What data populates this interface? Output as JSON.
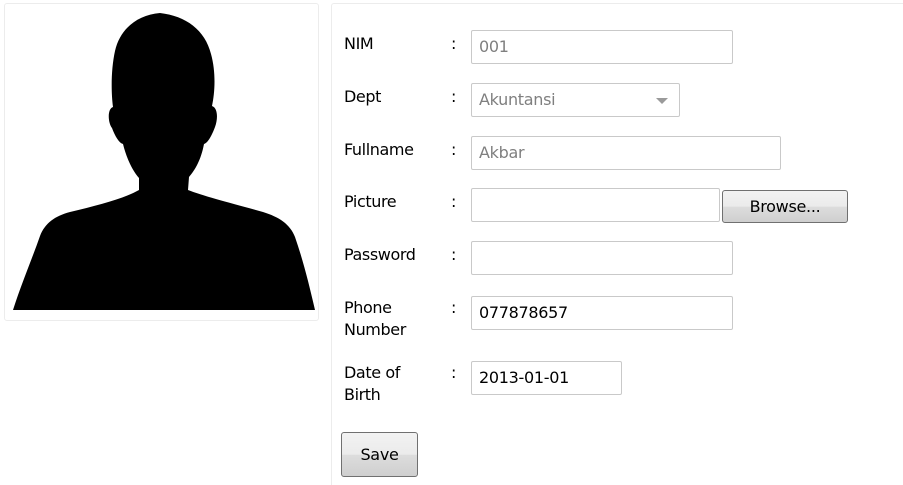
{
  "form": {
    "nim": {
      "label": "NIM",
      "value": "001"
    },
    "dept": {
      "label": "Dept",
      "value": "Akuntansi"
    },
    "fullname": {
      "label": "Fullname",
      "value": "Akbar"
    },
    "picture": {
      "label": "Picture",
      "value": ""
    },
    "password": {
      "label": "Password",
      "value": ""
    },
    "phone": {
      "label_line1": "Phone",
      "label_line2": "Number",
      "value": "077878657"
    },
    "dob": {
      "label_line1": "Date of",
      "label_line2": "Birth",
      "value": "2013-01-01"
    },
    "separator": ":",
    "browse_label": "Browse...",
    "save_label": "Save"
  },
  "icons": {
    "photo": "person-silhouette-icon",
    "dropdown": "chevron-down-icon"
  }
}
